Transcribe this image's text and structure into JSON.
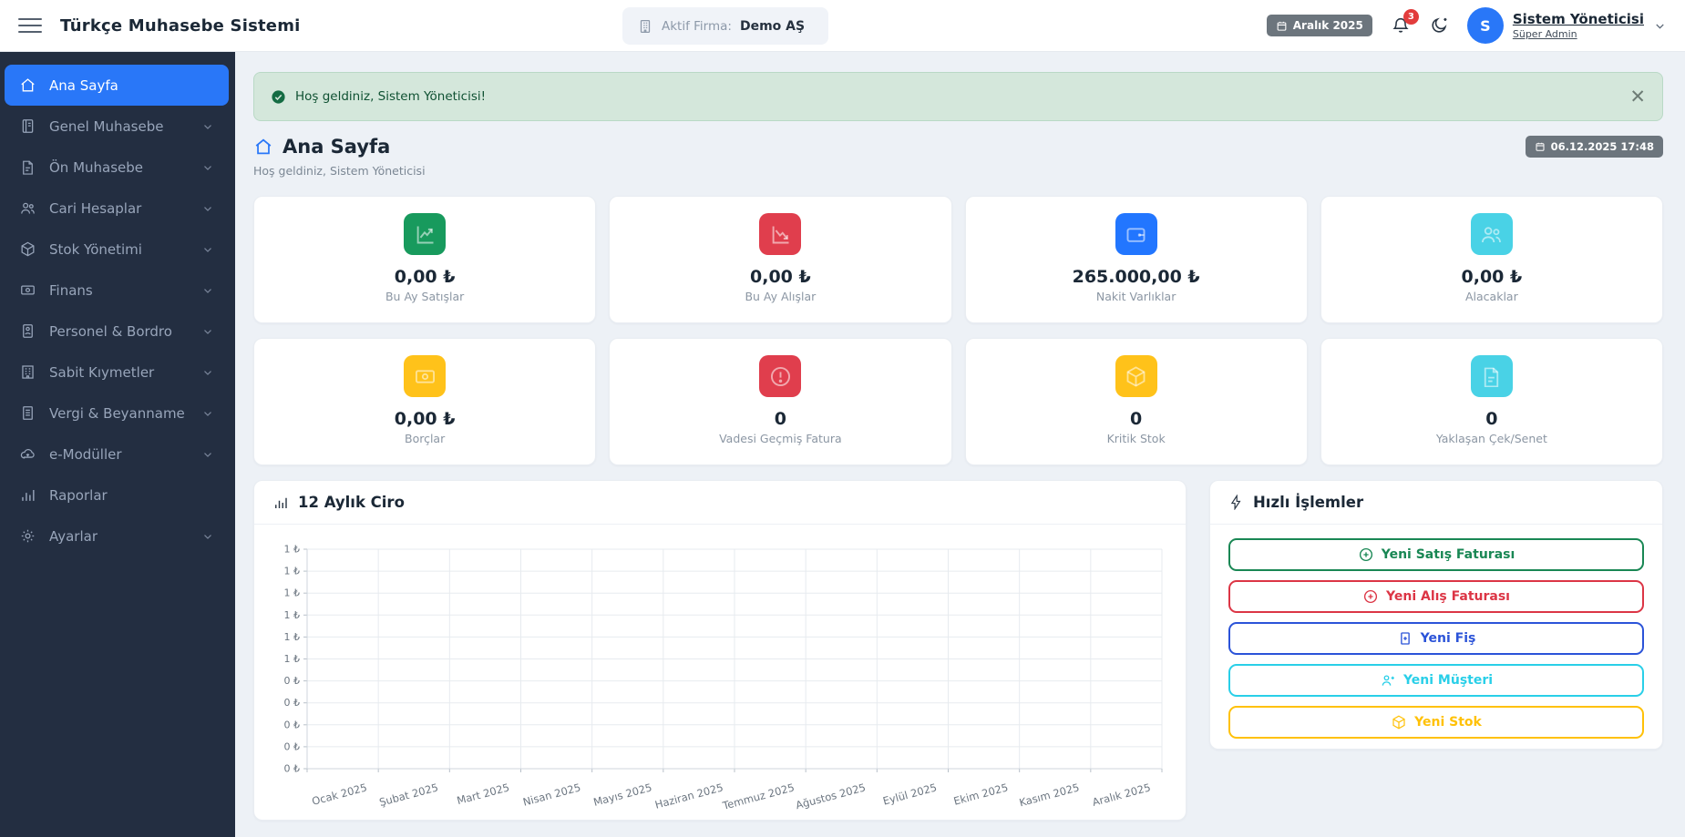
{
  "header": {
    "app_title": "Türkçe Muhasebe Sistemi",
    "active_company_label": "Aktif Firma:",
    "active_company": "Demo AŞ",
    "period_badge": "Aralık 2025",
    "notification_count": "3",
    "avatar_letter": "S",
    "user_name": "Sistem Yöneticisi",
    "user_role": "Süper Admin"
  },
  "sidebar": {
    "items": [
      {
        "id": "ana-sayfa",
        "label": "Ana Sayfa",
        "icon": "home-icon",
        "active": true,
        "chevron": false
      },
      {
        "id": "genel-muhasebe",
        "label": "Genel Muhasebe",
        "icon": "journal-icon",
        "active": false,
        "chevron": true
      },
      {
        "id": "on-muhasebe",
        "label": "Ön Muhasebe",
        "icon": "file-icon",
        "active": false,
        "chevron": true
      },
      {
        "id": "cari-hesaplar",
        "label": "Cari Hesaplar",
        "icon": "users-icon",
        "active": false,
        "chevron": true
      },
      {
        "id": "stok-yonetimi",
        "label": "Stok Yönetimi",
        "icon": "box-icon",
        "active": false,
        "chevron": true
      },
      {
        "id": "finans",
        "label": "Finans",
        "icon": "cash-icon",
        "active": false,
        "chevron": true
      },
      {
        "id": "personel-bordro",
        "label": "Personel & Bordro",
        "icon": "id-badge-icon",
        "active": false,
        "chevron": true
      },
      {
        "id": "sabit-kiymetler",
        "label": "Sabit Kıymetler",
        "icon": "building-icon",
        "active": false,
        "chevron": true
      },
      {
        "id": "vergi-beyanname",
        "label": "Vergi & Beyanname",
        "icon": "file-text-icon",
        "active": false,
        "chevron": true
      },
      {
        "id": "e-moduller",
        "label": "e-Modüller",
        "icon": "cloud-icon",
        "active": false,
        "chevron": true
      },
      {
        "id": "raporlar",
        "label": "Raporlar",
        "icon": "bar-chart-icon",
        "active": false,
        "chevron": false
      },
      {
        "id": "ayarlar",
        "label": "Ayarlar",
        "icon": "gear-icon",
        "active": false,
        "chevron": true
      }
    ]
  },
  "alert": {
    "text": "Hoş geldiniz, Sistem Yöneticisi!"
  },
  "page": {
    "title": "Ana Sayfa",
    "subtitle": "Hoş geldiniz, Sistem Yöneticisi",
    "datetime_badge": "06.12.2025 17:48"
  },
  "stats": {
    "row1": [
      {
        "value": "0,00 ₺",
        "label": "Bu Ay Satışlar",
        "icon": "trend-up-icon",
        "color": "#189a5d"
      },
      {
        "value": "0,00 ₺",
        "label": "Bu Ay Alışlar",
        "icon": "trend-down-icon",
        "color": "#e03e4d"
      },
      {
        "value": "265.000,00 ₺",
        "label": "Nakit Varlıklar",
        "icon": "wallet-icon",
        "color": "#2276ff"
      },
      {
        "value": "0,00 ₺",
        "label": "Alacaklar",
        "icon": "users-icon",
        "color": "#49d2e6"
      }
    ],
    "row2": [
      {
        "value": "0,00 ₺",
        "label": "Borçlar",
        "icon": "cash-icon",
        "color": "#ffc21a"
      },
      {
        "value": "0",
        "label": "Vadesi Geçmiş Fatura",
        "icon": "alert-circle-icon",
        "color": "#e03e4d"
      },
      {
        "value": "0",
        "label": "Kritik Stok",
        "icon": "box-icon",
        "color": "#ffc21a"
      },
      {
        "value": "0",
        "label": "Yaklaşan Çek/Senet",
        "icon": "file-icon",
        "color": "#49d2e6"
      }
    ]
  },
  "chart_panel": {
    "title": "12 Aylık Ciro"
  },
  "chart_data": {
    "type": "line",
    "title": "12 Aylık Ciro",
    "categories": [
      "Ocak 2025",
      "Şubat 2025",
      "Mart 2025",
      "Nisan 2025",
      "Mayıs 2025",
      "Haziran 2025",
      "Temmuz 2025",
      "Ağustos 2025",
      "Eylül 2025",
      "Ekim 2025",
      "Kasım 2025",
      "Aralık 2025"
    ],
    "values": [
      0,
      0,
      0,
      0,
      0,
      0,
      0,
      0,
      0,
      0,
      0,
      0
    ],
    "xlabel": "",
    "ylabel": "",
    "ylim": [
      0,
      1
    ],
    "y_tick_labels": [
      "1 ₺",
      "1 ₺",
      "1 ₺",
      "1 ₺",
      "1 ₺",
      "1 ₺",
      "0 ₺",
      "0 ₺",
      "0 ₺",
      "0 ₺",
      "0 ₺"
    ],
    "grid": true,
    "legend": false
  },
  "quick_actions": {
    "title": "Hızlı İşlemler",
    "buttons": [
      {
        "id": "yeni-satis-faturasi",
        "label": "Yeni Satış Faturası",
        "icon": "plus-circle-icon",
        "color": "#198754"
      },
      {
        "id": "yeni-alis-faturasi",
        "label": "Yeni Alış Faturası",
        "icon": "plus-circle-icon",
        "color": "#dc3545"
      },
      {
        "id": "yeni-fis",
        "label": "Yeni Fiş",
        "icon": "receipt-icon",
        "color": "#2b53d8"
      },
      {
        "id": "yeni-musteri",
        "label": "Yeni Müşteri",
        "icon": "person-plus-icon",
        "color": "#29cfe8"
      },
      {
        "id": "yeni-stok",
        "label": "Yeni Stok",
        "icon": "box-icon",
        "color": "#ffc107"
      }
    ]
  }
}
